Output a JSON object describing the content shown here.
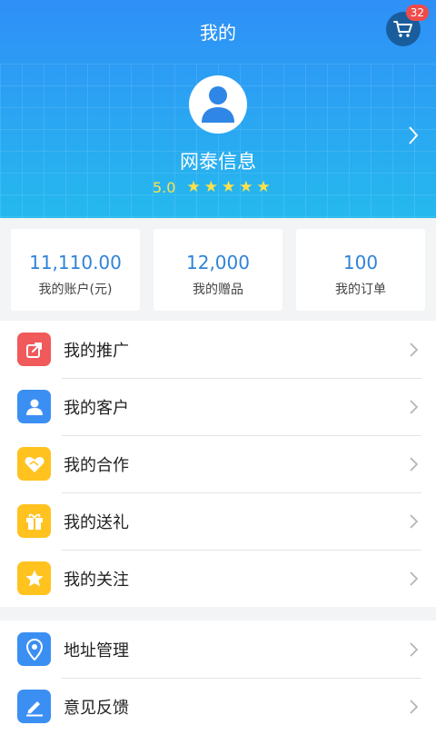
{
  "header": {
    "title": "我的",
    "cart_badge": "32"
  },
  "profile": {
    "name": "网泰信息",
    "rating": "5.0",
    "stars": 5,
    "avatar_icon": "user-icon"
  },
  "stats": [
    {
      "value": "11,110.00",
      "label": "我的账户(元)"
    },
    {
      "value": "12,000",
      "label": "我的赠品"
    },
    {
      "value": "100",
      "label": "我的订单"
    }
  ],
  "menu_primary": [
    {
      "label": "我的推广",
      "icon": "share-icon",
      "color": "#f05a5a"
    },
    {
      "label": "我的客户",
      "icon": "user-card-icon",
      "color": "#3b8ff3"
    },
    {
      "label": "我的合作",
      "icon": "handshake-icon",
      "color": "#ffc21f"
    },
    {
      "label": "我的送礼",
      "icon": "gift-icon",
      "color": "#ffc21f"
    },
    {
      "label": "我的关注",
      "icon": "star-icon",
      "color": "#ffc21f"
    }
  ],
  "menu_secondary": [
    {
      "label": "地址管理",
      "icon": "location-icon",
      "color": "#3b8ff3"
    },
    {
      "label": "意见反馈",
      "icon": "edit-icon",
      "color": "#3b8ff3"
    }
  ],
  "colors": {
    "header_top": "#2f8ff7",
    "header_bottom": "#25b9ee",
    "accent_blue": "#2f83d8",
    "star_yellow": "#ffe24a"
  }
}
